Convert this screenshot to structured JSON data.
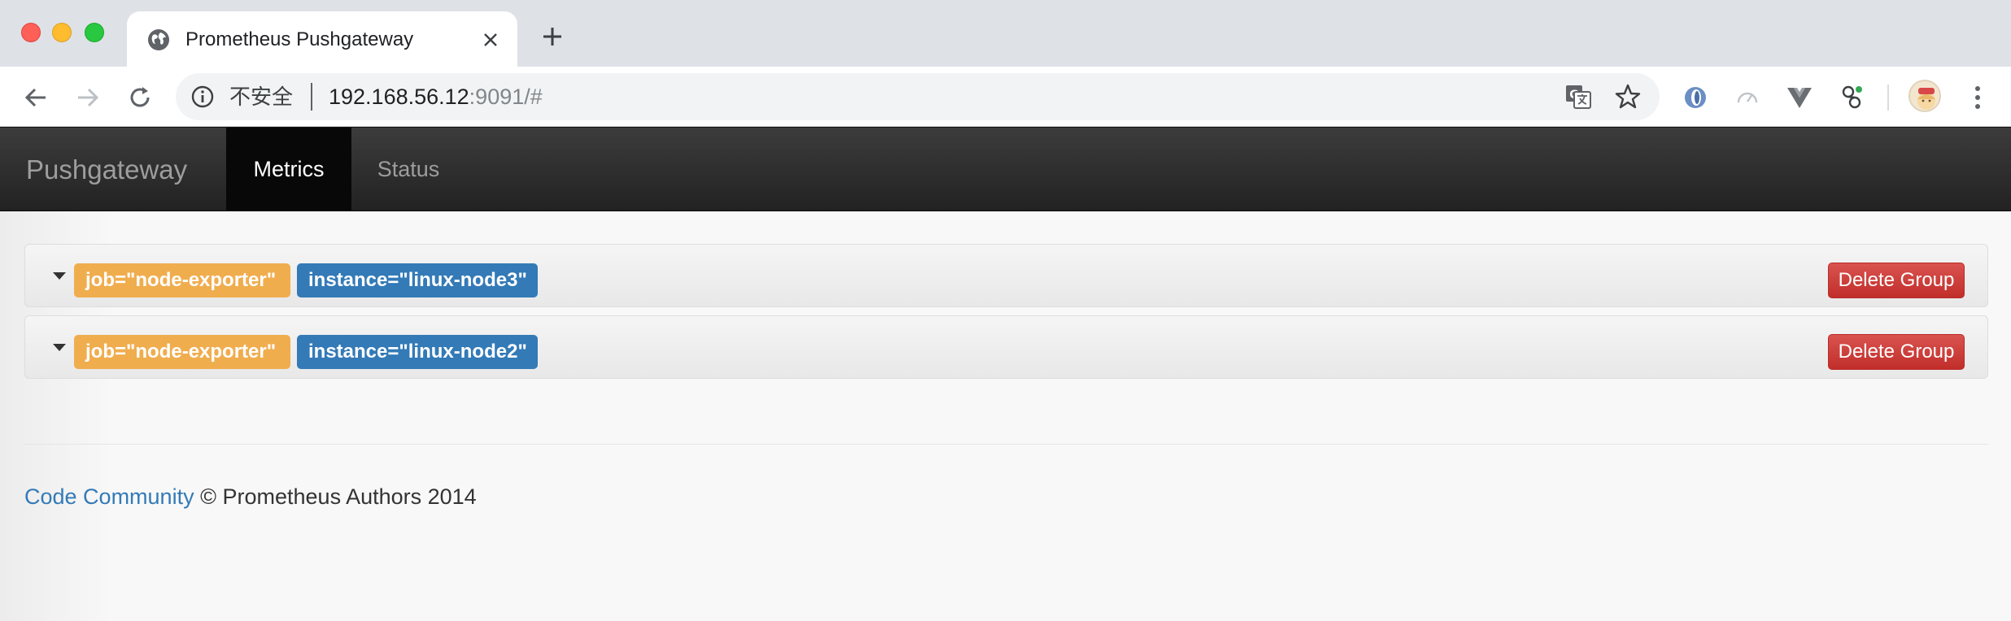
{
  "browser": {
    "tab_title": "Prometheus Pushgateway",
    "security_label": "不安全",
    "url_host": "192.168.56.12",
    "url_rest": ":9091/#"
  },
  "navbar": {
    "brand": "Pushgateway",
    "items": [
      {
        "label": "Metrics",
        "active": true
      },
      {
        "label": "Status",
        "active": false
      }
    ]
  },
  "groups": [
    {
      "job_label": "job=\"node-exporter\"",
      "instance_label": "instance=\"linux-node3\"",
      "delete_label": "Delete Group"
    },
    {
      "job_label": "job=\"node-exporter\"",
      "instance_label": "instance=\"linux-node2\"",
      "delete_label": "Delete Group"
    }
  ],
  "footer": {
    "link_text": "Code Community",
    "text": "© Prometheus Authors 2014"
  },
  "colors": {
    "job_label": "#f0ad4e",
    "instance_label": "#337ab7",
    "danger": "#d9534f",
    "navbar": "#222222"
  },
  "icons": [
    "globe-icon",
    "close-icon",
    "plus-icon",
    "back-arrow-icon",
    "forward-arrow-icon",
    "reload-icon",
    "info-icon",
    "translate-icon",
    "star-icon",
    "caret-down-icon"
  ]
}
